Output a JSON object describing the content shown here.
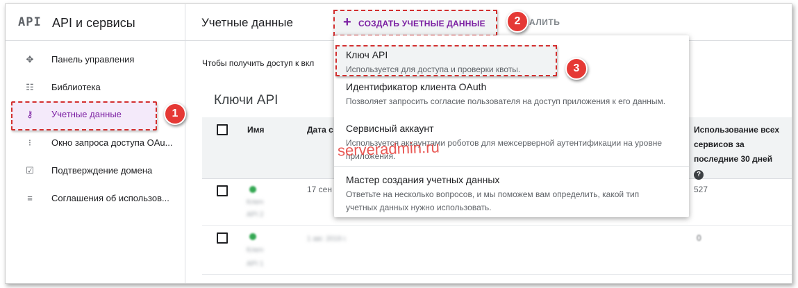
{
  "sidebar": {
    "logo": "API",
    "title": "API и сервисы",
    "items": [
      {
        "icon": "dashboard-icon",
        "label": "Панель управления"
      },
      {
        "icon": "library-icon",
        "label": "Библиотека"
      },
      {
        "icon": "key-icon",
        "label": "Учетные данные"
      },
      {
        "icon": "oauth-consent-icon",
        "label": "Окно запроса доступа OAu..."
      },
      {
        "icon": "domain-verification-icon",
        "label": "Подтверждение домена"
      },
      {
        "icon": "agreements-icon",
        "label": "Соглашения об использов..."
      }
    ]
  },
  "header": {
    "title": "Учетные данные",
    "create_label": "СОЗДАТЬ УЧЕТНЫЕ ДАННЫЕ",
    "delete_label": "АЛИТЬ"
  },
  "content": {
    "intro": "Чтобы получить доступ к вкл",
    "section_title": "Ключи API",
    "columns": {
      "name": "Имя",
      "date": "Дата с",
      "usage": "Использование всех сервисов за последние 30 дней"
    },
    "rows": [
      {
        "name_line1": "Ключ",
        "name_line2": "API 2",
        "date": "17 сен",
        "usage": "527"
      },
      {
        "name_line1": "Ключ",
        "name_line2": "API 1",
        "date": "1 авг. 2019 г.",
        "usage": "0"
      }
    ]
  },
  "menu": {
    "items": [
      {
        "title": "Ключ API",
        "desc": "Используется для доступа и проверки квоты."
      },
      {
        "title": "Идентификатор клиента OAuth",
        "desc": "Позволяет запросить согласие пользователя на доступ приложения к его данным."
      },
      {
        "title": "Сервисный аккаунт",
        "desc": "Используется аккаунтами роботов для межсерверной аутентификации на уровне приложения."
      },
      {
        "title": "Мастер создания учетных данных",
        "desc": "Ответьте на несколько вопросов, и мы поможем вам определить, какой тип учетных данных нужно использовать."
      }
    ]
  },
  "annotations": {
    "step1": "1",
    "step2": "2",
    "step3": "3",
    "watermark": "serveradmin.ru"
  },
  "colors": {
    "accent": "#7b1fa2",
    "annotation": "#d32f2f"
  }
}
